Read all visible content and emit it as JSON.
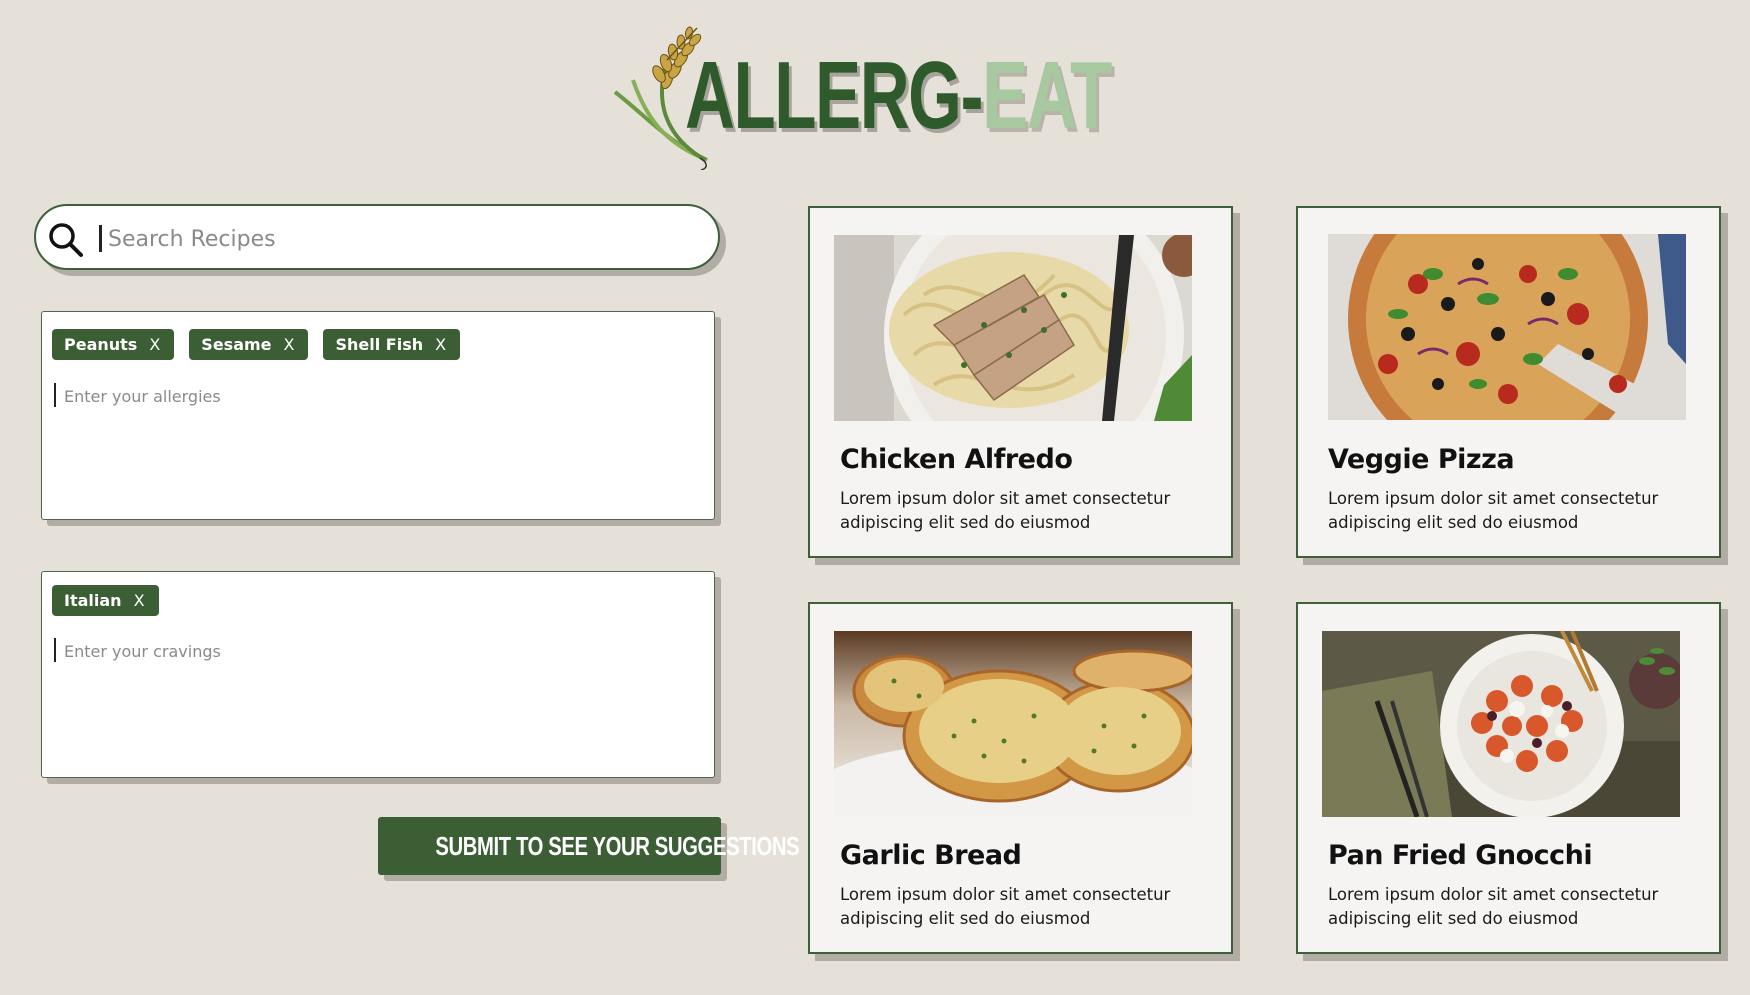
{
  "logo": {
    "text_dark": "ALLERG-",
    "text_light": "EAT"
  },
  "search": {
    "placeholder": "Search Recipes",
    "value": ""
  },
  "allergies": {
    "tags": [
      {
        "label": "Peanuts",
        "remove": "X"
      },
      {
        "label": "Sesame",
        "remove": "X"
      },
      {
        "label": "Shell Fish",
        "remove": "X"
      }
    ],
    "placeholder": "Enter your allergies"
  },
  "cravings": {
    "tags": [
      {
        "label": "Italian",
        "remove": "X"
      }
    ],
    "placeholder": "Enter your cravings"
  },
  "submit": {
    "label": "SUBMIT TO SEE YOUR SUGGESTIONS"
  },
  "recipes": [
    {
      "title": "Chicken Alfredo",
      "description": "Lorem ipsum dolor sit amet consectetur adipiscing elit sed do eiusmod"
    },
    {
      "title": "Veggie Pizza",
      "description": "Lorem ipsum dolor sit amet consectetur adipiscing elit sed do eiusmod"
    },
    {
      "title": "Garlic Bread",
      "description": "Lorem ipsum dolor sit amet consectetur adipiscing elit sed do eiusmod"
    },
    {
      "title": "Pan Fried Gnocchi",
      "description": "Lorem ipsum dolor sit amet consectetur adipiscing elit sed do eiusmod"
    }
  ],
  "colors": {
    "background": "#e6e1d8",
    "primary_green": "#3c5e34",
    "light_green": "#a8c9a0",
    "card_background": "#f5f4f2"
  }
}
